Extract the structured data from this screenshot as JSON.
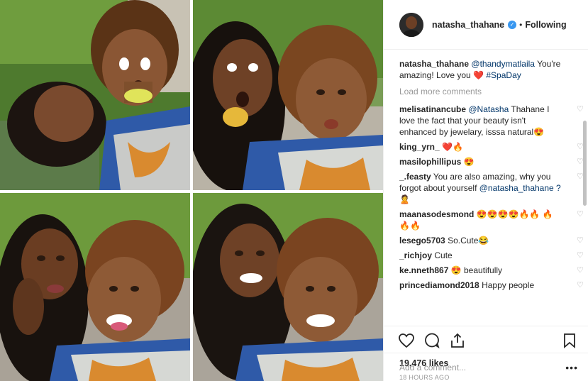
{
  "header": {
    "username": "natasha_thahane",
    "separator": "•",
    "follow_label": "Following"
  },
  "caption": {
    "username": "natasha_thahane",
    "mention": "@thandymatlaila",
    "text": "You're amazing! Love you",
    "emoji": "❤️",
    "hashtag": "#SpaDay"
  },
  "load_more": "Load more comments",
  "comments": [
    {
      "user": "melisatinancube",
      "mention": "@Natasha",
      "text": "Thahane I love the fact that your beauty isn't enhanced by jewelary, isssa natural😍"
    },
    {
      "user": "king_yrn_",
      "mention": "",
      "text": "❤️🔥"
    },
    {
      "user": "masilophillipus",
      "mention": "",
      "text": "😍"
    },
    {
      "user": "_.feasty",
      "mention": "",
      "text": "You are also amazing, why you forgot about yourself"
    },
    {
      "user": "maanasodesmond",
      "mention": "",
      "text": "😍😍😍😍🔥🔥 🔥🔥🔥"
    },
    {
      "user": "lesego5703",
      "mention": "",
      "text": "So.Cute😂"
    },
    {
      "user": "_richjoy",
      "mention": "",
      "text": "Cute"
    },
    {
      "user": "ke.nneth867",
      "mention": "",
      "text": "😍 beautifully"
    },
    {
      "user": "princediamond2018",
      "mention": "",
      "text": "Happy people"
    }
  ],
  "feasty_extra": "@natasha_thahane ?🙎",
  "likes": "19,476 likes",
  "time": "18 HOURS AGO",
  "add_comment_placeholder": "Add a comment...",
  "more_label": "•••",
  "colors": {
    "accent_link": "#003569",
    "verified": "#3897f0",
    "muted": "#999999",
    "heart": "#ed4956"
  }
}
